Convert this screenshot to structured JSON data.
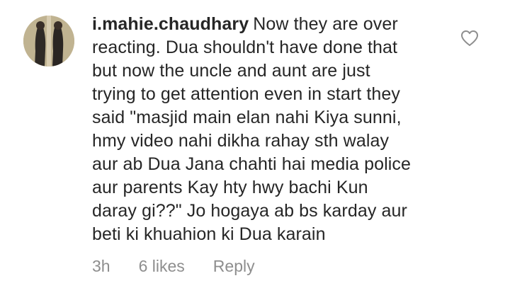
{
  "comment": {
    "username": "i.mahie.chaudhary",
    "lines": [
      "Now they are over",
      "reacting. Dua shouldn't have done that",
      "but now the uncle and aunt are just",
      "trying to get attention even in start they",
      "said \"masjid main elan nahi Kiya sunni,",
      "hmy video nahi dikha rahay sth walay",
      "aur ab Dua Jana chahti hai media police",
      "aur parents Kay hty hwy bachi Kun",
      "daray gi??\" Jo hogaya ab bs karday aur",
      "beti ki khuahion ki Dua karain"
    ],
    "time": "3h",
    "likes": "6 likes",
    "reply_label": "Reply",
    "heart_icon": "heart-outline-icon"
  },
  "colors": {
    "text": "#262626",
    "meta": "#8e8e8e"
  }
}
